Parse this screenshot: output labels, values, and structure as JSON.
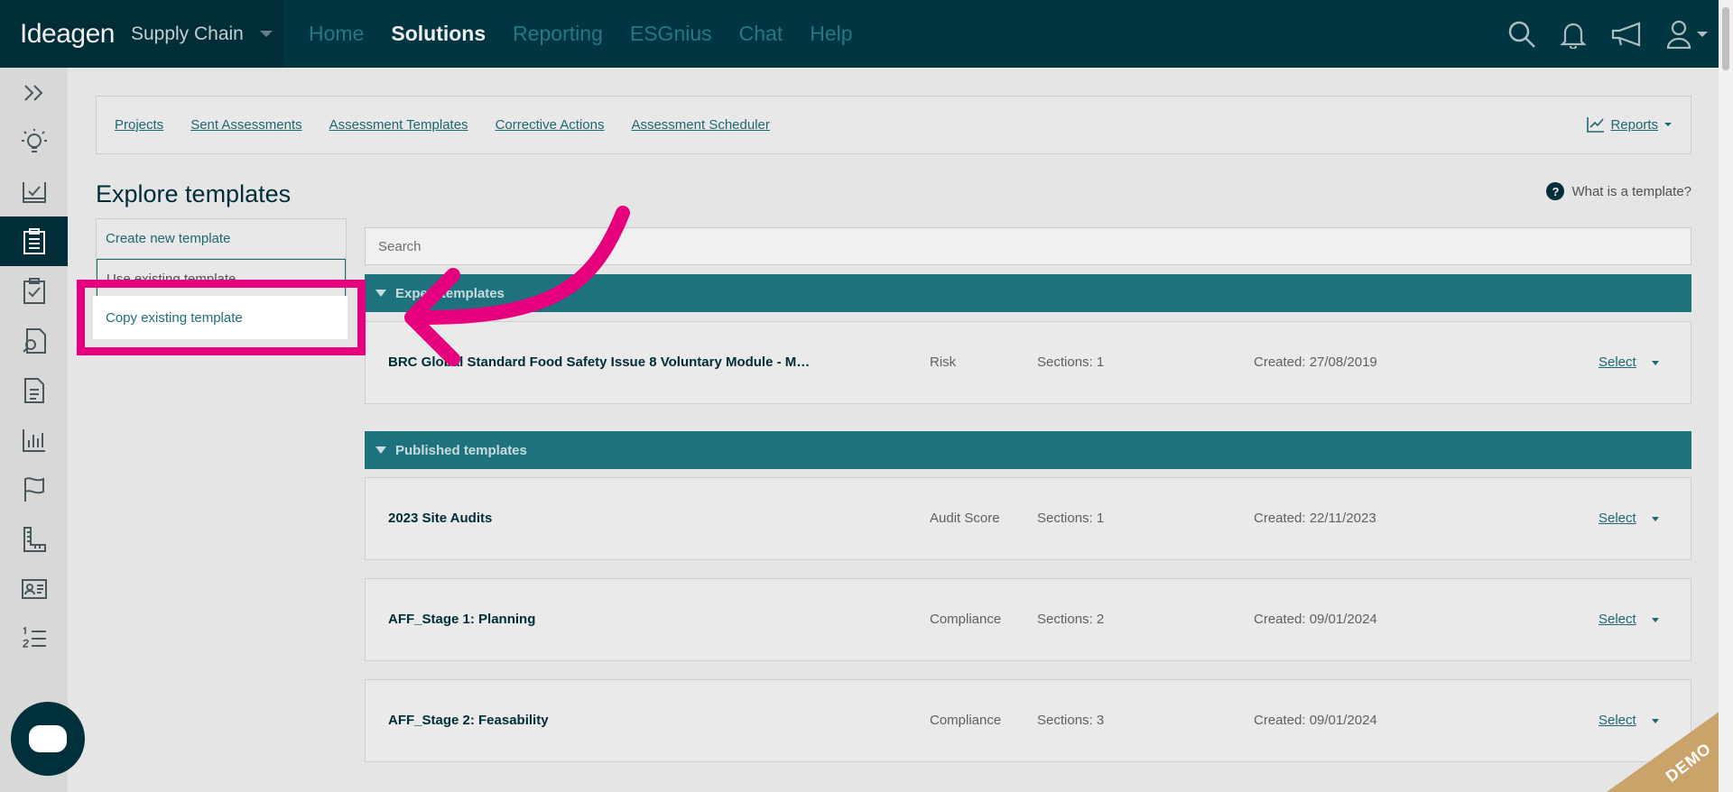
{
  "brand": {
    "logo": "Ideagen",
    "product": "Supply Chain"
  },
  "nav": [
    {
      "label": "Home",
      "active": false
    },
    {
      "label": "Solutions",
      "active": true
    },
    {
      "label": "Reporting",
      "active": false
    },
    {
      "label": "ESGnius",
      "active": false
    },
    {
      "label": "Chat",
      "active": false
    },
    {
      "label": "Help",
      "active": false
    }
  ],
  "subnav": {
    "links": [
      "Projects",
      "Sent Assessments",
      "Assessment Templates",
      "Corrective Actions",
      "Assessment Scheduler"
    ],
    "reports": "Reports"
  },
  "page": {
    "title": "Explore templates",
    "help": "What is a template?",
    "search_placeholder": "Search"
  },
  "menu": {
    "create": "Create new template",
    "use": "Use existing template",
    "copy": "Copy existing template"
  },
  "sections": {
    "expert": {
      "title": "Expert templates"
    },
    "published": {
      "title": "Published templates"
    }
  },
  "rows": [
    {
      "name": "BRC Global Standard Food Safety Issue 8 Voluntary Module - Me...",
      "type": "Risk",
      "sections": "Sections: 1",
      "created": "Created: 27/08/2019",
      "select": "Select"
    },
    {
      "name": "2023 Site Audits",
      "type": "Audit Score",
      "sections": "Sections: 1",
      "created": "Created: 22/11/2023",
      "select": "Select"
    },
    {
      "name": "AFF_Stage 1: Planning",
      "type": "Compliance",
      "sections": "Sections: 2",
      "created": "Created: 09/01/2024",
      "select": "Select"
    },
    {
      "name": "AFF_Stage 2: Feasability",
      "type": "Compliance",
      "sections": "Sections: 3",
      "created": "Created: 09/01/2024",
      "select": "Select"
    }
  ],
  "demo_badge": "DEMO",
  "colors": {
    "topbar": "#003a47",
    "accent": "#207a85",
    "highlight": "#e6007e"
  }
}
